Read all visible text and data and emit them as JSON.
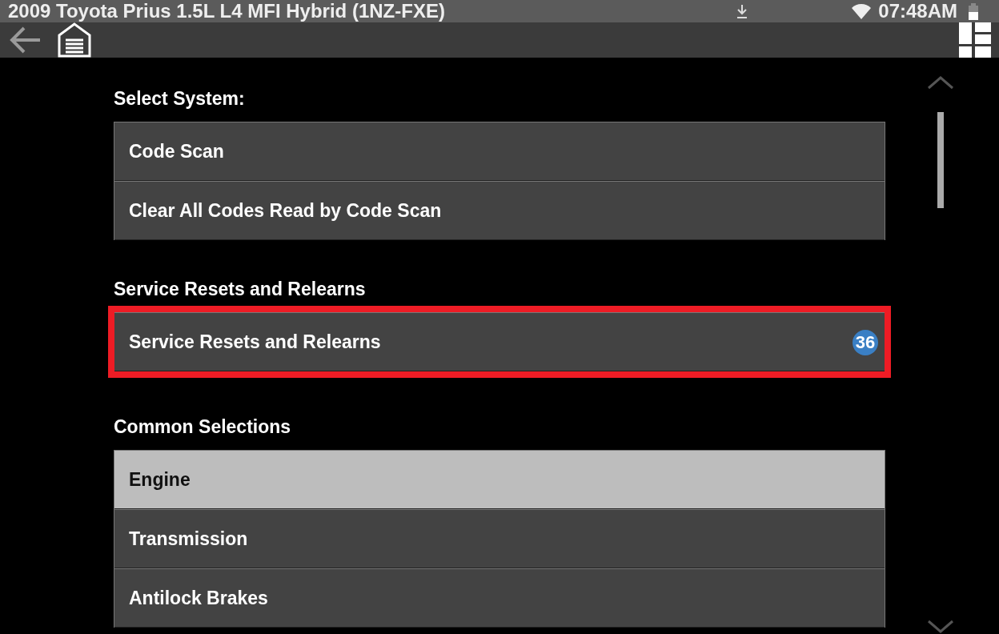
{
  "status_bar": {
    "title": "2009 Toyota Prius 1.5L L4 MFI Hybrid (1NZ-FXE)",
    "time": "07:48AM"
  },
  "sections": [
    {
      "heading": "Select System:",
      "items": [
        {
          "label": "Code Scan",
          "selected": false,
          "highlighted": false
        },
        {
          "label": "Clear All Codes Read by Code Scan",
          "selected": false,
          "highlighted": false
        }
      ]
    },
    {
      "heading": "Service Resets and Relearns",
      "items": [
        {
          "label": "Service Resets and Relearns",
          "selected": false,
          "highlighted": true,
          "badge": "36"
        }
      ]
    },
    {
      "heading": "Common Selections",
      "items": [
        {
          "label": "Engine",
          "selected": true,
          "highlighted": false
        },
        {
          "label": "Transmission",
          "selected": false,
          "highlighted": false
        },
        {
          "label": "Antilock Brakes",
          "selected": false,
          "highlighted": false
        }
      ]
    }
  ]
}
